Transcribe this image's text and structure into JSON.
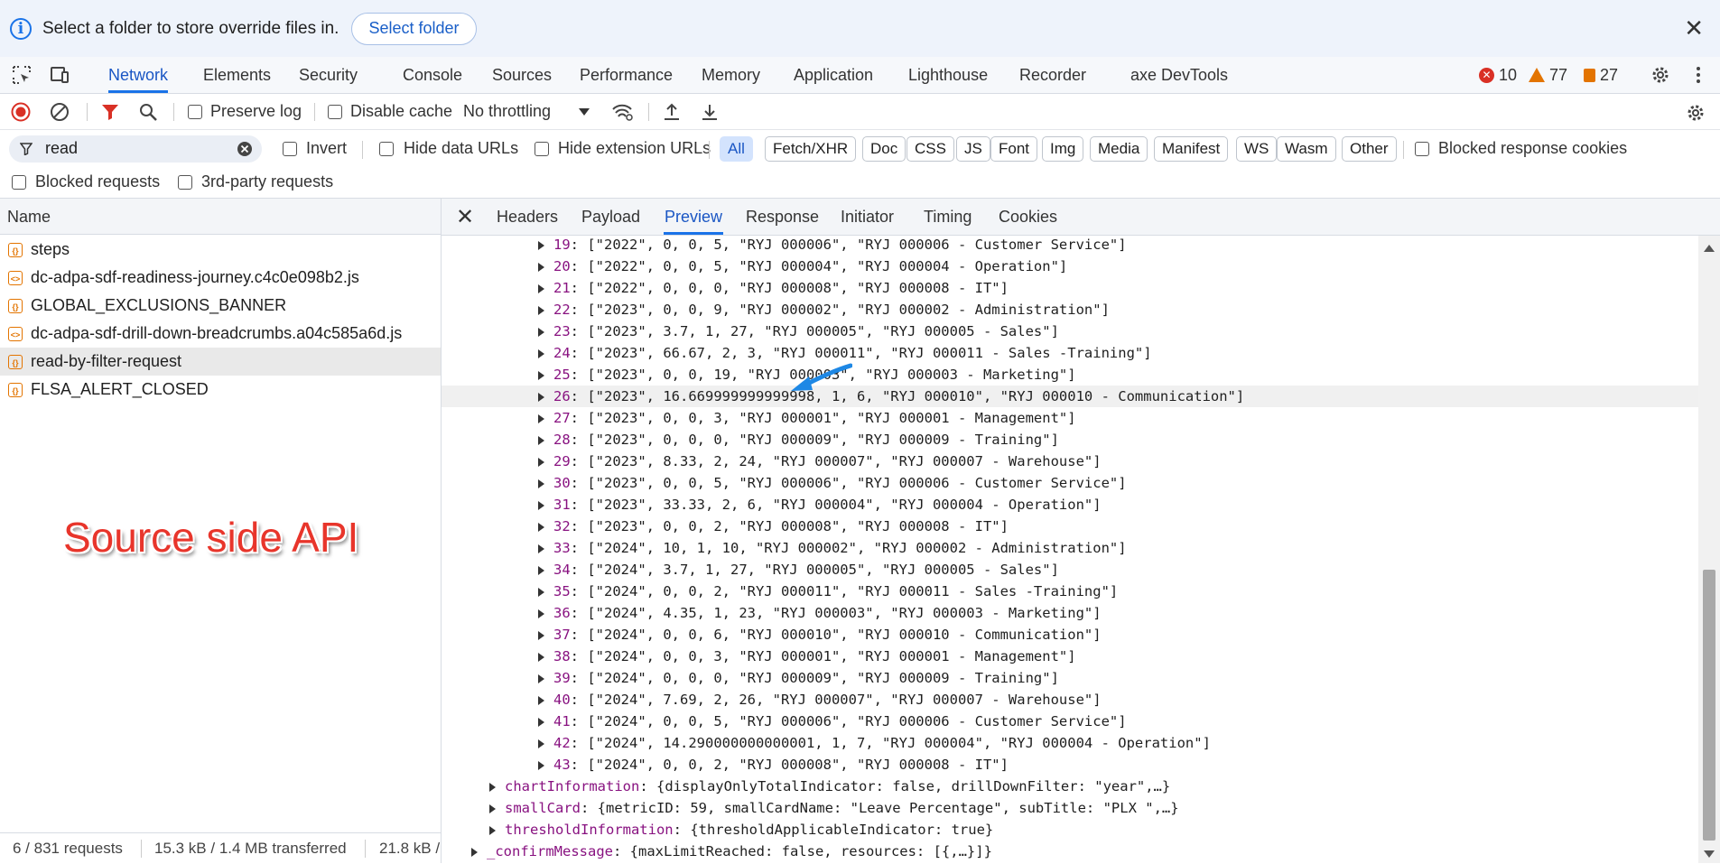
{
  "infobar": {
    "message": "Select a folder to store override files in.",
    "button": "Select folder",
    "info_glyph": "i",
    "close_glyph": "✕"
  },
  "tabs": [
    "Network",
    "Elements",
    "Security",
    "Console",
    "Sources",
    "Performance",
    "Memory",
    "Application",
    "Lighthouse",
    "Recorder",
    "axe DevTools"
  ],
  "counts": {
    "errors": "10",
    "warnings": "77",
    "issues": "27",
    "err_glyph": "✕"
  },
  "toolbar": {
    "preserve_log": "Preserve log",
    "disable_cache": "Disable cache",
    "throttling": "No throttling"
  },
  "filter": {
    "value": "read",
    "invert": "Invert",
    "hide_data_urls": "Hide data URLs",
    "hide_extension_urls": "Hide extension URLs",
    "types": [
      "All",
      "Fetch/XHR",
      "Doc",
      "CSS",
      "JS",
      "Font",
      "Img",
      "Media",
      "Manifest",
      "WS",
      "Wasm",
      "Other"
    ],
    "blocked_response_cookies": "Blocked response cookies",
    "blocked_requests": "Blocked requests",
    "third_party_requests": "3rd-party requests"
  },
  "requests": {
    "header": "Name",
    "items": [
      {
        "name": "steps",
        "icon": "{}"
      },
      {
        "name": "dc-adpa-sdf-readiness-journey.c4c0e098b2.js",
        "icon": "<>"
      },
      {
        "name": "GLOBAL_EXCLUSIONS_BANNER",
        "icon": "{}"
      },
      {
        "name": "dc-adpa-sdf-drill-down-breadcrumbs.a04c585a6d.js",
        "icon": "<>"
      },
      {
        "name": "read-by-filter-request",
        "icon": "{}"
      },
      {
        "name": "FLSA_ALERT_CLOSED",
        "icon": "{}"
      }
    ]
  },
  "annotation": "Source side API",
  "status": {
    "requests": "6 / 831 requests",
    "transferred": "15.3 kB / 1.4 MB transferred",
    "resources": "21.8 kB /"
  },
  "detail_tabs": [
    "Headers",
    "Payload",
    "Preview",
    "Response",
    "Initiator",
    "Timing",
    "Cookies"
  ],
  "detail_close": "✕",
  "preview_rows": [
    {
      "idx": "19",
      "value": "[\"2022\", 0, 0, 5, \"RYJ 000006\", \"RYJ 000006 - Customer Service\"]"
    },
    {
      "idx": "20",
      "value": "[\"2022\", 0, 0, 5, \"RYJ 000004\", \"RYJ 000004 - Operation\"]"
    },
    {
      "idx": "21",
      "value": "[\"2022\", 0, 0, 0, \"RYJ 000008\", \"RYJ 000008 - IT\"]"
    },
    {
      "idx": "22",
      "value": "[\"2023\", 0, 0, 9, \"RYJ 000002\", \"RYJ 000002 - Administration\"]"
    },
    {
      "idx": "23",
      "value": "[\"2023\", 3.7, 1, 27, \"RYJ 000005\", \"RYJ 000005 - Sales\"]"
    },
    {
      "idx": "24",
      "value": "[\"2023\", 66.67, 2, 3, \"RYJ 000011\", \"RYJ 000011 - Sales -Training\"]"
    },
    {
      "idx": "25",
      "value": "[\"2023\", 0, 0, 19, \"RYJ 000003\", \"RYJ 000003 - Marketing\"]"
    },
    {
      "idx": "26",
      "value": "[\"2023\", 16.669999999999998, 1, 6, \"RYJ 000010\", \"RYJ 000010 - Communication\"]"
    },
    {
      "idx": "27",
      "value": "[\"2023\", 0, 0, 3, \"RYJ 000001\", \"RYJ 000001 - Management\"]"
    },
    {
      "idx": "28",
      "value": "[\"2023\", 0, 0, 0, \"RYJ 000009\", \"RYJ 000009 - Training\"]"
    },
    {
      "idx": "29",
      "value": "[\"2023\", 8.33, 2, 24, \"RYJ 000007\", \"RYJ 000007 - Warehouse\"]"
    },
    {
      "idx": "30",
      "value": "[\"2023\", 0, 0, 5, \"RYJ 000006\", \"RYJ 000006 - Customer Service\"]"
    },
    {
      "idx": "31",
      "value": "[\"2023\", 33.33, 2, 6, \"RYJ 000004\", \"RYJ 000004 - Operation\"]"
    },
    {
      "idx": "32",
      "value": "[\"2023\", 0, 0, 2, \"RYJ 000008\", \"RYJ 000008 - IT\"]"
    },
    {
      "idx": "33",
      "value": "[\"2024\", 10, 1, 10, \"RYJ 000002\", \"RYJ 000002 - Administration\"]"
    },
    {
      "idx": "34",
      "value": "[\"2024\", 3.7, 1, 27, \"RYJ 000005\", \"RYJ 000005 - Sales\"]"
    },
    {
      "idx": "35",
      "value": "[\"2024\", 0, 0, 2, \"RYJ 000011\", \"RYJ 000011 - Sales -Training\"]"
    },
    {
      "idx": "36",
      "value": "[\"2024\", 4.35, 1, 23, \"RYJ 000003\", \"RYJ 000003 - Marketing\"]"
    },
    {
      "idx": "37",
      "value": "[\"2024\", 0, 0, 6, \"RYJ 000010\", \"RYJ 000010 - Communication\"]"
    },
    {
      "idx": "38",
      "value": "[\"2024\", 0, 0, 3, \"RYJ 000001\", \"RYJ 000001 - Management\"]"
    },
    {
      "idx": "39",
      "value": "[\"2024\", 0, 0, 0, \"RYJ 000009\", \"RYJ 000009 - Training\"]"
    },
    {
      "idx": "40",
      "value": "[\"2024\", 7.69, 2, 26, \"RYJ 000007\", \"RYJ 000007 - Warehouse\"]"
    },
    {
      "idx": "41",
      "value": "[\"2024\", 0, 0, 5, \"RYJ 000006\", \"RYJ 000006 - Customer Service\"]"
    },
    {
      "idx": "42",
      "value": "[\"2024\", 14.290000000000001, 1, 7, \"RYJ 000004\", \"RYJ 000004 - Operation\"]"
    },
    {
      "idx": "43",
      "value": "[\"2024\", 0, 0, 2, \"RYJ 000008\", \"RYJ 000008 - IT\"]"
    }
  ],
  "preview_props": [
    {
      "key": "chartInformation",
      "value": "{displayOnlyTotalIndicator: false, drillDownFilter: \"year\",…}"
    },
    {
      "key": "smallCard",
      "value": "{metricID: 59, smallCardName: \"Leave Percentage\", subTitle: \"PLX \",…}"
    },
    {
      "key": "thresholdInformation",
      "value": "{thresholdApplicableIndicator: true}"
    },
    {
      "key": "_confirmMessage",
      "value": "{maxLimitReached: false, resources: [{,…}]}"
    }
  ],
  "colors": {
    "accent": "#1a73e8",
    "annotation": "#e8352b",
    "error": "#d93025",
    "warning": "#e37400",
    "property_key": "#881280"
  }
}
